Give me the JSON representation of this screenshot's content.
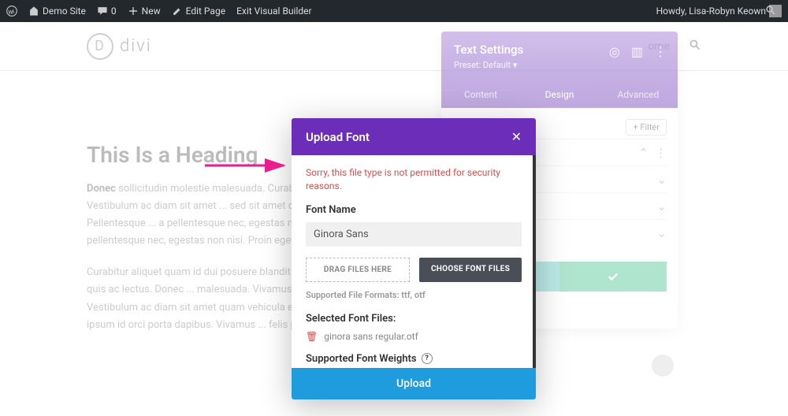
{
  "adminbar": {
    "site": "Demo Site",
    "comments": "0",
    "new": "New",
    "edit": "Edit Page",
    "exit": "Exit Visual Builder",
    "greeting": "Howdy, Lisa-Robyn Keown"
  },
  "logo": {
    "letter": "D",
    "text": "divi"
  },
  "header_right": {
    "menu_item": "ome"
  },
  "page": {
    "heading": "This Is a Heading",
    "para1_lead": "Donec",
    "para1": " sollicitudin molestie malesuada. Curabitur ... posuere blandit. Vestibulum ac diam sit amet ... sed sit amet dui. Proin eget tortor risus. Pellentesque ... a pellentesque nec, egestas non nisi. Curabitur ... pellentesque nec, egestas non nisi. Proin eget ... porttitor volutpat.",
    "para2": "Curabitur aliquet quam id dui posuere blandit ... amet nisl tempus convallis quis ac lectus. Donec ... malesuada. Vivamus suscipit tortor eget felis ... Vestibulum ac diam sit amet quam vehicula elementum ... Pellentesque in ipsum id orci porta dapibus. Vivamus ... felis porttitor volutpat."
  },
  "settings": {
    "title": "Text Settings",
    "preset": "Preset: Default ▾",
    "tabs": {
      "content": "Content",
      "design": "Design",
      "advanced": "Advanced"
    },
    "filter": "+ Filter"
  },
  "modal": {
    "title": "Upload Font",
    "error": "Sorry, this file type is not permitted for security reasons.",
    "font_name_label": "Font Name",
    "font_name_value": "Ginora Sans",
    "drag": "DRAG FILES HERE",
    "choose": "CHOOSE FONT FILES",
    "formats": "Supported File Formats: ttf, otf",
    "selected_label": "Selected Font Files:",
    "selected_file": "ginora sans regular.otf",
    "weights_label": "Supported Font Weights",
    "upload": "Upload"
  }
}
